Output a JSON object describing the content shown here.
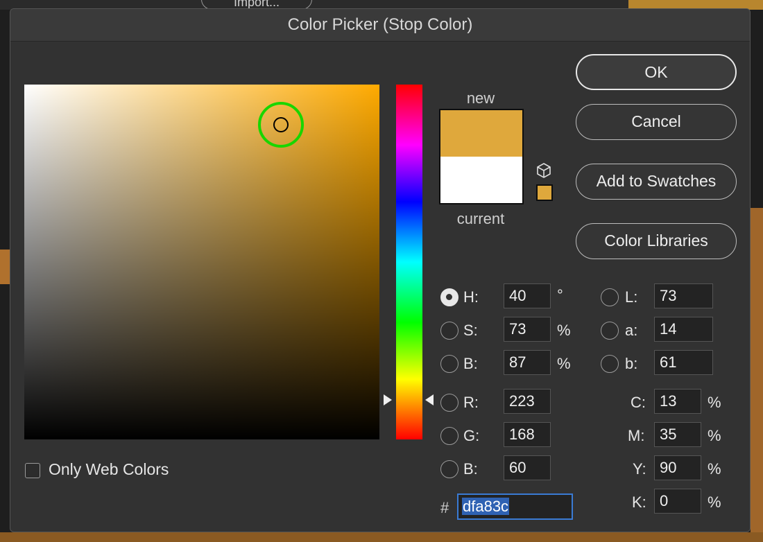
{
  "window": {
    "title": "Color Picker (Stop Color)"
  },
  "background": {
    "import_label": "Import..."
  },
  "preview": {
    "new_label": "new",
    "current_label": "current",
    "new_color": "#dfa83c",
    "current_color": "#ffffff",
    "hue_color": "#ffaa00"
  },
  "buttons": {
    "ok": "OK",
    "cancel": "Cancel",
    "add_to_swatches": "Add to Swatches",
    "color_libraries": "Color Libraries"
  },
  "hsb": {
    "h": {
      "label": "H:",
      "value": "40",
      "unit": "°",
      "selected": true
    },
    "s": {
      "label": "S:",
      "value": "73",
      "unit": "%"
    },
    "b": {
      "label": "B:",
      "value": "87",
      "unit": "%"
    }
  },
  "rgb": {
    "r": {
      "label": "R:",
      "value": "223"
    },
    "g": {
      "label": "G:",
      "value": "168"
    },
    "b": {
      "label": "B:",
      "value": "60"
    }
  },
  "lab": {
    "l": {
      "label": "L:",
      "value": "73"
    },
    "a": {
      "label": "a:",
      "value": "14"
    },
    "b": {
      "label": "b:",
      "value": "61"
    }
  },
  "cmyk": {
    "c": {
      "label": "C:",
      "value": "13",
      "unit": "%"
    },
    "m": {
      "label": "M:",
      "value": "35",
      "unit": "%"
    },
    "y": {
      "label": "Y:",
      "value": "90",
      "unit": "%"
    },
    "k": {
      "label": "K:",
      "value": "0",
      "unit": "%"
    }
  },
  "hex": {
    "label": "#",
    "value": "dfa83c"
  },
  "web_colors": {
    "label": "Only Web Colors",
    "checked": false
  },
  "icons": {
    "gamut": "cube-icon",
    "websafe": "websafe-swatch"
  }
}
